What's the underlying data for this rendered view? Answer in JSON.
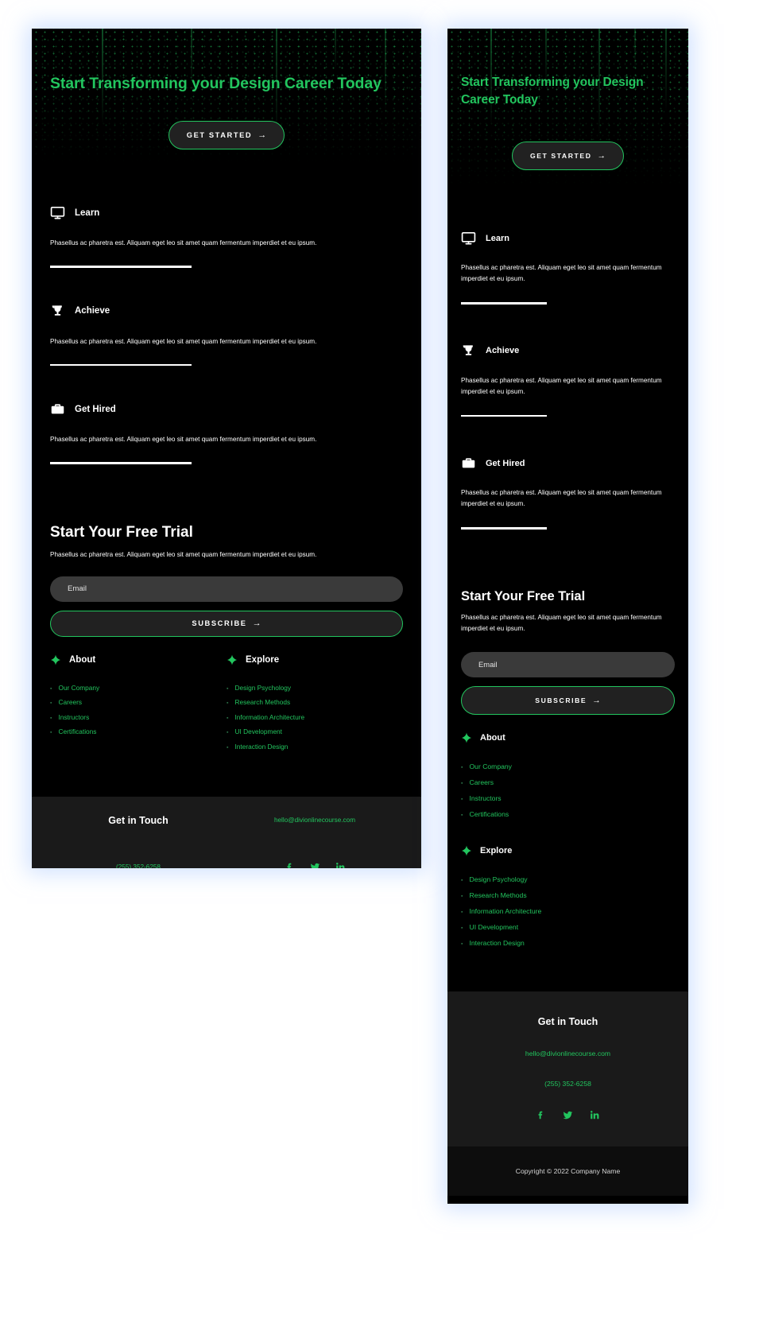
{
  "theme": {
    "accent_green": "#22c55e",
    "page_background": "#000000",
    "contact_bar_background": "#1a1a1a",
    "copyright_bar_background": "#0d0d0d",
    "input_background": "#3a3a3a"
  },
  "hero": {
    "title": "Start Transforming your Design Career Today",
    "cta_label": "GET STARTED",
    "cta_arrow": "→",
    "background_icon": "matrix-dots-background"
  },
  "features": [
    {
      "icon": "monitor-icon",
      "title": "Learn",
      "description": "Phasellus ac pharetra est. Aliquam eget leo sit amet quam fermentum imperdiet et eu ipsum."
    },
    {
      "icon": "trophy-icon",
      "title": "Achieve",
      "description": "Phasellus ac pharetra est. Aliquam eget leo sit amet quam fermentum imperdiet et eu ipsum."
    },
    {
      "icon": "briefcase-icon",
      "title": "Get Hired",
      "description": "Phasellus ac pharetra est. Aliquam eget leo sit amet quam fermentum imperdiet et eu ipsum."
    }
  ],
  "trial": {
    "title": "Start Your Free Trial",
    "description": "Phasellus ac pharetra est. Aliquam eget leo sit amet quam fermentum imperdiet et eu ipsum.",
    "email_placeholder": "Email",
    "email_value": "",
    "subscribe_label": "SUBSCRIBE",
    "subscribe_arrow": "→"
  },
  "link_columns": [
    {
      "icon": "sparkle-icon",
      "heading": "About",
      "links": [
        "Our Company",
        "Careers",
        "Instructors",
        "Certifications"
      ]
    },
    {
      "icon": "sparkle-icon",
      "heading": "Explore",
      "links": [
        "Design Psychology",
        "Research Methods",
        "Information Architecture",
        "UI Development",
        "Interaction Design"
      ]
    }
  ],
  "contact": {
    "title": "Get in Touch",
    "email": "hello@divionlinecourse.com",
    "phone": "(255) 352-6258",
    "socials": [
      {
        "icon": "facebook-icon",
        "label": "f"
      },
      {
        "icon": "twitter-icon",
        "label": "t"
      },
      {
        "icon": "linkedin-icon",
        "label": "in"
      }
    ]
  },
  "copyright": {
    "text": "Copyright © 2022 Company Name"
  },
  "bullet_glyph": "▪"
}
